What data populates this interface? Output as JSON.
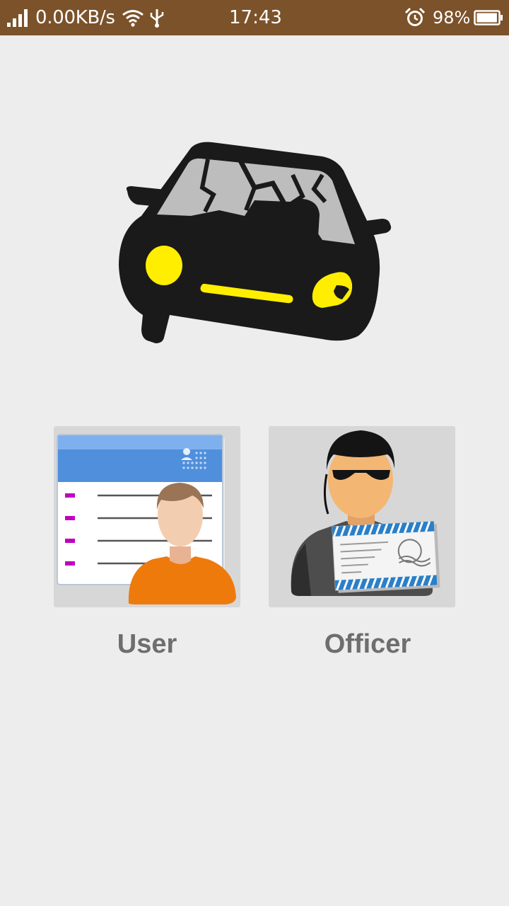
{
  "status_bar": {
    "net_speed": "0.00KB/s",
    "time": "17:43",
    "battery_percent": "98%",
    "battery_level": 0.98,
    "background_color": "#7b522a",
    "icons": [
      "signal-icon",
      "wifi-icon",
      "usb-icon",
      "alarm-icon",
      "battery-icon"
    ]
  },
  "logo": {
    "icon": "crashed-car-logo",
    "body_color": "#1a1a1a",
    "light_color": "#ffee00",
    "glass_color": "#bdbdbd"
  },
  "roles": [
    {
      "id": "user",
      "label": "User",
      "icon": "user-contact-card-icon"
    },
    {
      "id": "officer",
      "label": "Officer",
      "icon": "officer-badge-icon"
    }
  ],
  "colors": {
    "background": "#ededed",
    "card_background": "#d7d7d7",
    "label_text": "#6e6e6e"
  }
}
